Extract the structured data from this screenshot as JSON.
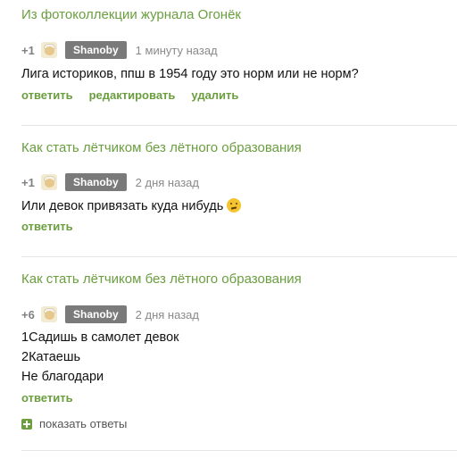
{
  "comments": [
    {
      "post_title": "Из фотоколлекции журнала Огонёк",
      "rating": "+1",
      "username": "Shanoby",
      "time": "1 минуту назад",
      "text_lines": [
        "Лига историков, ппш в 1954 году это норм или не норм?"
      ],
      "actions": [
        "ответить",
        "редактировать",
        "удалить"
      ]
    },
    {
      "post_title": "Как стать лётчиком без лётного образования",
      "rating": "+1",
      "username": "Shanoby",
      "time": "2 дня назад",
      "text_lines": [
        "Или девок привязать куда нибудь"
      ],
      "actions": [
        "ответить"
      ]
    },
    {
      "post_title": "Как стать лётчиком без лётного образования",
      "rating": "+6",
      "username": "Shanoby",
      "time": "2 дня назад",
      "text_lines": [
        "1Садишь в самолет  девок",
        "2Катаешь",
        "Не благодари"
      ],
      "actions": [
        "ответить"
      ],
      "show_replies": "показать ответы"
    }
  ],
  "icons": {
    "avatar": "user-avatar-icon",
    "emoji": "thinking-face-emoji-icon",
    "expand": "plus-square-icon"
  },
  "colors": {
    "accent": "#6a9e3f",
    "badge": "#7a7a7a",
    "divider": "#e6e6e6"
  }
}
